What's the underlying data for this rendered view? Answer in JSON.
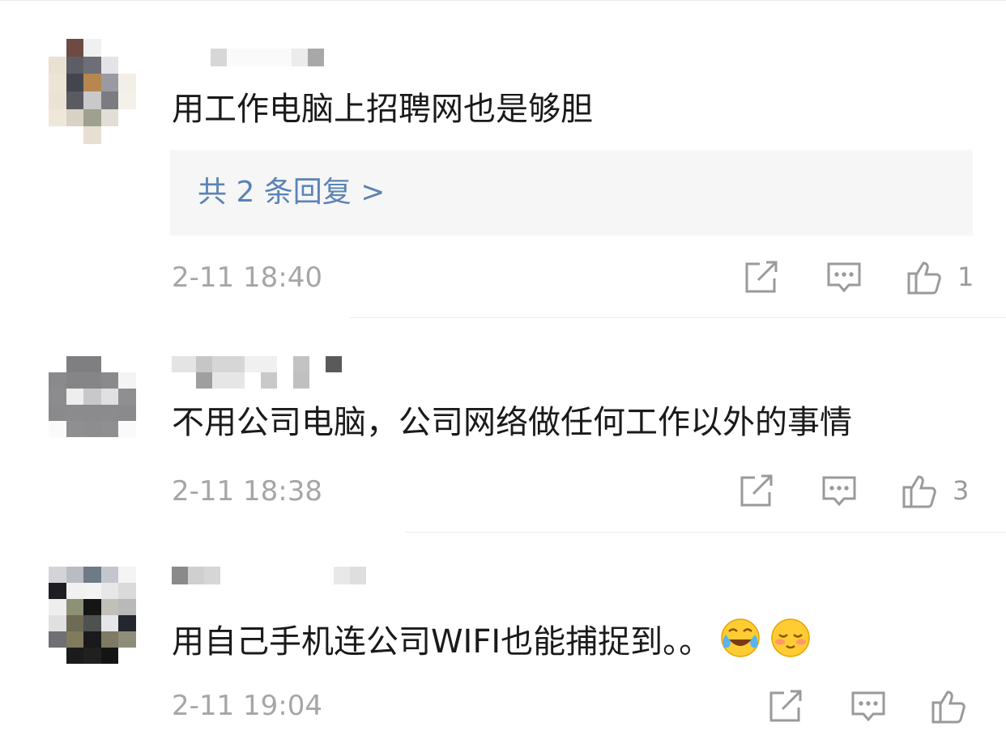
{
  "comments": [
    {
      "text": "用工作电脑上招聘网也是够胆",
      "replies_label": "共 2 条回复 >",
      "time": "2-11 18:40",
      "like_count": "1",
      "icons": [
        "share-icon",
        "comment-icon",
        "like-icon"
      ]
    },
    {
      "text": "不用公司电脑，公司网络做任何工作以外的事情",
      "time": "2-11 18:38",
      "like_count": "3",
      "icons": [
        "share-icon",
        "comment-icon",
        "like-icon"
      ]
    },
    {
      "text": "用自己手机连公司WIFI也能捕捉到。。",
      "emojis": [
        "laugh-cry-emoji",
        "blush-emoji"
      ],
      "time": "2-11 19:04",
      "like_count": "",
      "icons": [
        "share-icon",
        "comment-icon",
        "like-icon"
      ]
    }
  ],
  "colors": {
    "link": "#5b83b5",
    "timestamp": "#a6a6a6",
    "reply_bg": "#f6f6f6",
    "icon": "#9a9a9a"
  }
}
